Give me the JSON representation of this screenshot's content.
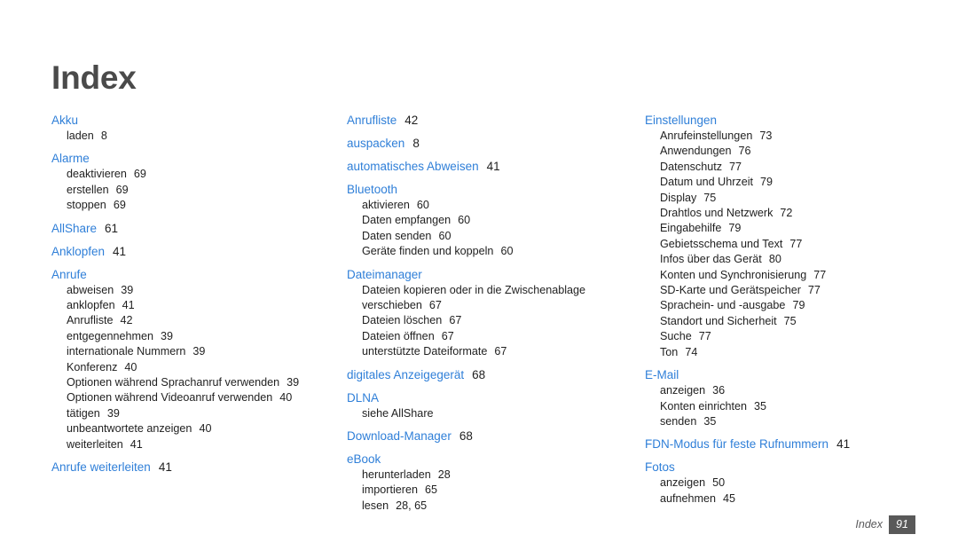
{
  "document": {
    "title": "Index",
    "accent_color": "#2f7fd8",
    "title_color": "#4a4a4a",
    "body_color": "#1f1f1f",
    "background_color": "#ffffff"
  },
  "footer": {
    "label": "Index",
    "page_number": "91",
    "page_box_color": "#595959"
  },
  "columns": [
    {
      "id": "column-1",
      "groups": [
        {
          "head": "Akku",
          "page": "",
          "subs": [
            {
              "label": "laden",
              "page": "8"
            }
          ]
        },
        {
          "head": "Alarme",
          "page": "",
          "subs": [
            {
              "label": "deaktivieren",
              "page": "69"
            },
            {
              "label": "erstellen",
              "page": "69"
            },
            {
              "label": "stoppen",
              "page": "69"
            }
          ]
        },
        {
          "head": "AllShare",
          "page": "61",
          "subs": []
        },
        {
          "head": "Anklopfen",
          "page": "41",
          "subs": []
        },
        {
          "head": "Anrufe",
          "page": "",
          "subs": [
            {
              "label": "abweisen",
              "page": "39"
            },
            {
              "label": "anklopfen",
              "page": "41"
            },
            {
              "label": "Anrufliste",
              "page": "42"
            },
            {
              "label": "entgegennehmen",
              "page": "39"
            },
            {
              "label": "internationale Nummern",
              "page": "39"
            },
            {
              "label": "Konferenz",
              "page": "40"
            },
            {
              "label": "Optionen während Sprachanruf verwenden",
              "page": "39",
              "wrapped": true
            },
            {
              "label": "Optionen während Videoanruf verwenden",
              "page": "40",
              "wrapped": true
            },
            {
              "label": "tätigen",
              "page": "39"
            },
            {
              "label": "unbeantwortete anzeigen",
              "page": "40"
            },
            {
              "label": "weiterleiten",
              "page": "41"
            }
          ]
        },
        {
          "head": "Anrufe weiterleiten",
          "page": "41",
          "subs": []
        }
      ]
    },
    {
      "id": "column-2",
      "groups": [
        {
          "head": "Anrufliste",
          "page": "42",
          "subs": []
        },
        {
          "head": "auspacken",
          "page": "8",
          "subs": []
        },
        {
          "head": "automatisches Abweisen",
          "page": "41",
          "subs": []
        },
        {
          "head": "Bluetooth",
          "page": "",
          "subs": [
            {
              "label": "aktivieren",
              "page": "60"
            },
            {
              "label": "Daten empfangen",
              "page": "60"
            },
            {
              "label": "Daten senden",
              "page": "60"
            },
            {
              "label": "Geräte finden und koppeln",
              "page": "60"
            }
          ]
        },
        {
          "head": "Dateimanager",
          "page": "",
          "subs": [
            {
              "label": "Dateien kopieren oder in die Zwischenablage verschieben",
              "page": "67",
              "wrapped": true
            },
            {
              "label": "Dateien löschen",
              "page": "67"
            },
            {
              "label": "Dateien öffnen",
              "page": "67"
            },
            {
              "label": "unterstützte Dateiformate",
              "page": "67"
            }
          ]
        },
        {
          "head": "digitales Anzeigegerät",
          "page": "68",
          "subs": []
        },
        {
          "head": "DLNA",
          "page": "",
          "subs": [
            {
              "label": "siehe AllShare",
              "page": ""
            }
          ]
        },
        {
          "head": "Download-Manager",
          "page": "68",
          "subs": []
        },
        {
          "head": "eBook",
          "page": "",
          "subs": [
            {
              "label": "herunterladen",
              "page": "28"
            },
            {
              "label": "importieren",
              "page": "65"
            },
            {
              "label": "lesen",
              "page": "28, 65"
            }
          ]
        }
      ]
    },
    {
      "id": "column-3",
      "groups": [
        {
          "head": "Einstellungen",
          "page": "",
          "subs": [
            {
              "label": "Anrufeinstellungen",
              "page": "73"
            },
            {
              "label": "Anwendungen",
              "page": "76"
            },
            {
              "label": "Datenschutz",
              "page": "77"
            },
            {
              "label": "Datum und Uhrzeit",
              "page": "79"
            },
            {
              "label": "Display",
              "page": "75"
            },
            {
              "label": "Drahtlos und Netzwerk",
              "page": "72"
            },
            {
              "label": "Eingabehilfe",
              "page": "79"
            },
            {
              "label": "Gebietsschema und Text",
              "page": "77"
            },
            {
              "label": "Infos über das Gerät",
              "page": "80"
            },
            {
              "label": "Konten und Synchronisierung",
              "page": "77"
            },
            {
              "label": "SD-Karte und Gerätspeicher",
              "page": "77"
            },
            {
              "label": "Sprachein- und -ausgabe",
              "page": "79"
            },
            {
              "label": "Standort und Sicherheit",
              "page": "75"
            },
            {
              "label": "Suche",
              "page": "77"
            },
            {
              "label": "Ton",
              "page": "74"
            }
          ]
        },
        {
          "head": "E-Mail",
          "page": "",
          "subs": [
            {
              "label": "anzeigen",
              "page": "36"
            },
            {
              "label": "Konten einrichten",
              "page": "35"
            },
            {
              "label": "senden",
              "page": "35"
            }
          ]
        },
        {
          "head": "FDN-Modus für feste Rufnummern",
          "page": "41",
          "subs": []
        },
        {
          "head": "Fotos",
          "page": "",
          "subs": [
            {
              "label": "anzeigen",
              "page": "50"
            },
            {
              "label": "aufnehmen",
              "page": "45"
            }
          ]
        }
      ]
    }
  ]
}
